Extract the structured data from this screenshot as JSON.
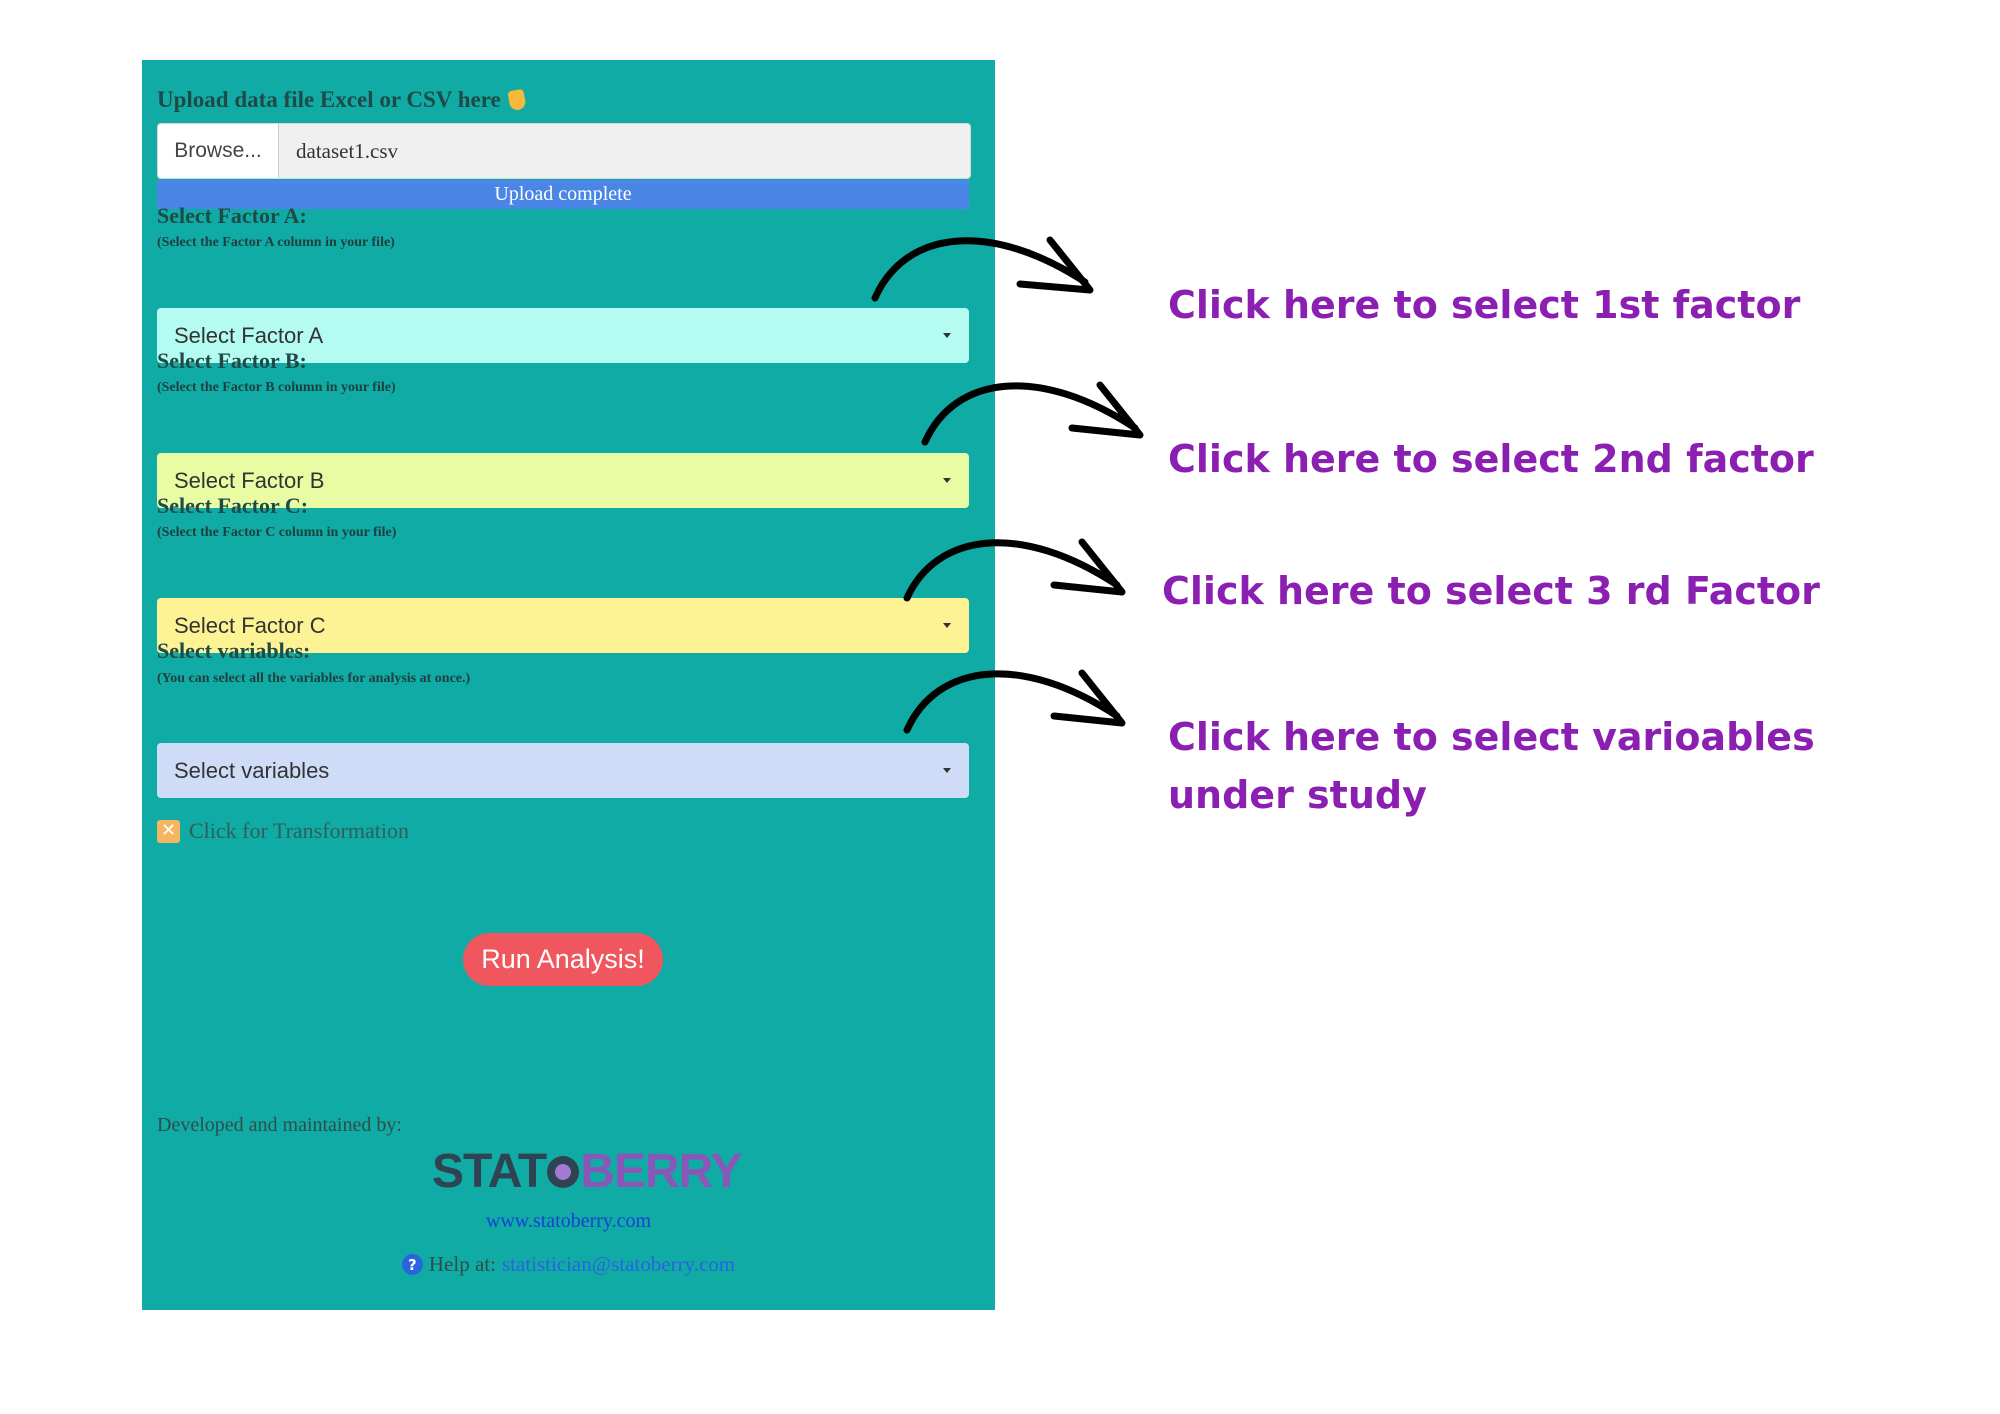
{
  "panel": {
    "upload_label": "Upload data file Excel or CSV here",
    "browse_label": "Browse...",
    "file_name": "dataset1.csv",
    "progress_text": "Upload complete",
    "progress_value": 1.0,
    "factors": [
      {
        "label": "Select Factor A:",
        "help": "(Select the Factor A column in your file)",
        "placeholder": "Select Factor A",
        "color": "#b4fbf2"
      },
      {
        "label": "Select Factor B:",
        "help": "(Select the Factor B column in your file)",
        "placeholder": "Select Factor B",
        "color": "#e9fca3"
      },
      {
        "label": "Select Factor C:",
        "help": "(Select the Factor C column in your file)",
        "placeholder": "Select Factor C",
        "color": "#fdf294"
      },
      {
        "label": "Select variables:",
        "help": "(You can select all the variables for analysis at once.)",
        "placeholder": "Select variables",
        "color": "#cfdcf7"
      }
    ],
    "checkbox_mark": "✕",
    "checkbox_label": "Click for Transformation",
    "run_button": "Run Analysis!",
    "developed_by": "Developed and maintained by:",
    "logo_stat": "STAT",
    "logo_berry": "BERRY",
    "website": "www.statoberry.com",
    "help_icon": "?",
    "help_label": "Help at:",
    "help_email": "statistician@statoberry.com",
    "colors": {
      "panel_bg": "#10aba5",
      "progress": "#4a86e6",
      "run_button": "#f0565d",
      "annotation": "#8b1fb2"
    }
  },
  "annotations": [
    {
      "text": "Click here to select 1st factor"
    },
    {
      "text": "Click here to select 2nd factor"
    },
    {
      "text": "Click here to select 3 rd Factor"
    },
    {
      "text": "Click here to select varioables",
      "text2": "under study"
    }
  ]
}
